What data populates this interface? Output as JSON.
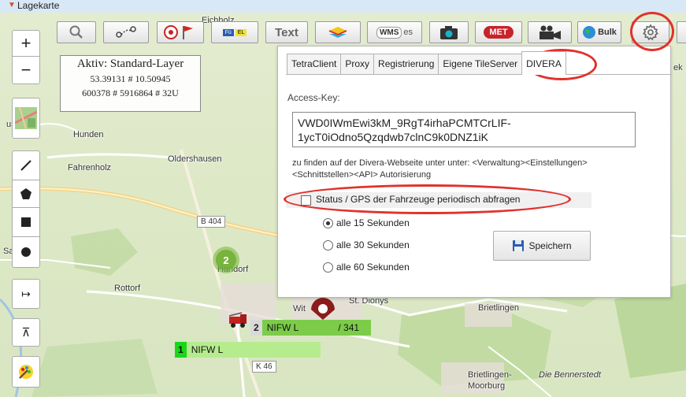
{
  "window": {
    "title": "Lagekarte"
  },
  "toolbar": {
    "text_label": "Text",
    "wms_label": "WMS",
    "met_label": "MET",
    "bulk_label": "Bulk",
    "fu_label": "Fü",
    "el_label": "EL",
    "icons": [
      "search-icon",
      "route-icon",
      "marker-flag-icon",
      "fu-el-icon",
      "layers-icon",
      "wms-icon",
      "camera-icon",
      "met-icon",
      "video-camera-icon",
      "globe-bulk-icon",
      "gear-icon"
    ]
  },
  "map": {
    "info": {
      "title": "Aktiv: Standard-Layer",
      "latlon": "53.39131 # 10.50945",
      "utm": "600378 # 5916864 # 32U"
    },
    "places": {
      "eichholz": "Eichholz",
      "hunden": "Hunden",
      "oldershausen": "Oldershausen",
      "fahrenholz": "Fahrenholz",
      "handorf": "Handorf",
      "rottorf": "Rottorf",
      "st_dionys": "St. Dionys",
      "brietlingen": "Brietlingen",
      "brietlingen_moorburg_1": "Brietlingen-",
      "brietlingen_moorburg_2": "Moorburg",
      "bennerstedt": "Die Bennerstedt",
      "sa_edt": "Sa    edt",
      "wit": "Wit",
      "hus": "us",
      "ek": "ek"
    },
    "roads": {
      "b404": "B 404",
      "k46": "K 46"
    },
    "cluster_count": "2",
    "vehicles": [
      {
        "num": "2",
        "name": "NIFW L",
        "suffix": "/ 341"
      },
      {
        "num": "1",
        "name": "NIFW L",
        "suffix": ""
      }
    ]
  },
  "controls": {
    "zoom_in": "+",
    "zoom_out": "−",
    "arrow_label": "↦",
    "top_label": "⊼"
  },
  "dialog": {
    "tabs": [
      {
        "label": "TetraClient",
        "active": false
      },
      {
        "label": "Proxy",
        "active": false
      },
      {
        "label": "Registrierung",
        "active": false
      },
      {
        "label": "Eigene TileServer",
        "active": false
      },
      {
        "label": "DIVERA",
        "active": true
      }
    ],
    "access_key_label": "Access-Key:",
    "access_key_value": "VWD0IWmEwi3kM_9RgT4irhaPCMTCrLIF-\n1ycT0iOdno5Qzqdwb7clnC9k0DNZ1iK",
    "hint_line1": "zu finden auf der Divera-Webseite unter unter: <Verwaltung><Einstellungen>",
    "hint_line2": "<Schnittstellen><API>  Autorisierung",
    "status_checkbox_label": "Status / GPS der Fahrzeuge periodisch abfragen",
    "status_checked": false,
    "intervals": [
      {
        "label": "alle 15 Sekunden",
        "selected": true
      },
      {
        "label": "alle 30 Sekunden",
        "selected": false
      },
      {
        "label": "alle 60 Sekunden",
        "selected": false
      }
    ],
    "save_label": "Speichern",
    "hidden_tab_fragment": "es"
  },
  "colors": {
    "annotation_red": "#e0322c",
    "vehicle_green": "#6ec83c",
    "vehicle_bright_green": "#19d619",
    "save_blue": "#2a5db0"
  }
}
